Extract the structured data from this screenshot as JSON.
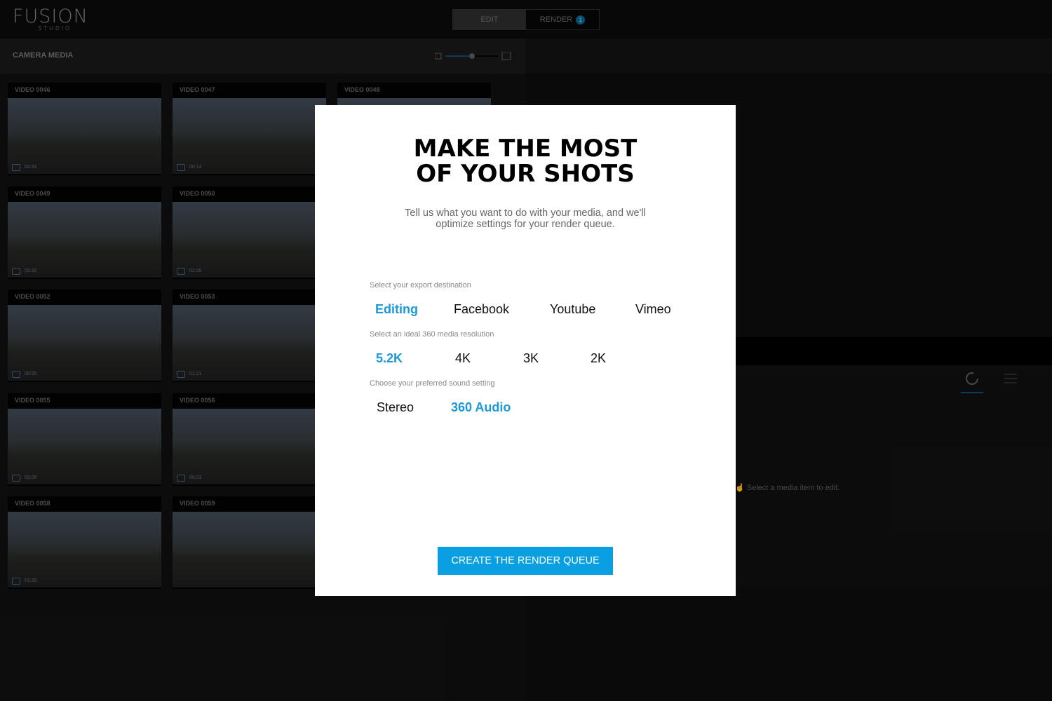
{
  "app": {
    "logo": "FUSION",
    "logo_sub": "STUDIO"
  },
  "modes": {
    "edit": "EDIT",
    "render": "RENDER",
    "render_badge": "1"
  },
  "media": {
    "title": "CAMERA MEDIA",
    "items": [
      {
        "name": "VIDEO 0046",
        "duration": "04:32"
      },
      {
        "name": "VIDEO 0047",
        "duration": "00:14"
      },
      {
        "name": "VIDEO 0048",
        "duration": ""
      },
      {
        "name": "VIDEO 0049",
        "duration": "00:32"
      },
      {
        "name": "VIDEO 0050",
        "duration": "02:35"
      },
      {
        "name": "VIDEO 0052",
        "duration": "00:55"
      },
      {
        "name": "VIDEO 0053",
        "duration": "01:21"
      },
      {
        "name": "VIDEO 0055",
        "duration": "02:06"
      },
      {
        "name": "VIDEO 0056",
        "duration": "00:31"
      },
      {
        "name": "VIDEO 0058",
        "duration": "01:33"
      },
      {
        "name": "VIDEO 0059",
        "duration": ""
      }
    ]
  },
  "right": {
    "hint": "Select a media item to edit."
  },
  "modal": {
    "title_line1": "MAKE THE MOST",
    "title_line2": "OF YOUR SHOTS",
    "subtitle_line1": "Tell us what you want to do with your media, and we'll",
    "subtitle_line2": "optimize settings for your render queue.",
    "destination_label": "Select your export destination",
    "destinations": [
      "Editing",
      "Facebook",
      "Youtube",
      "Vimeo"
    ],
    "destination_selected": "Editing",
    "resolution_label": "Select an ideal 360 media resolution",
    "resolutions": [
      "5.2K",
      "4K",
      "3K",
      "2K"
    ],
    "resolution_selected": "5.2K",
    "sound_label": "Choose your preferred sound setting",
    "sounds": [
      "Stereo",
      "360 Audio"
    ],
    "sound_selected": "360 Audio",
    "cta": "CREATE THE RENDER QUEUE"
  },
  "colors": {
    "accent": "#0a9fe0",
    "selected_text": "#1a9ad6"
  }
}
